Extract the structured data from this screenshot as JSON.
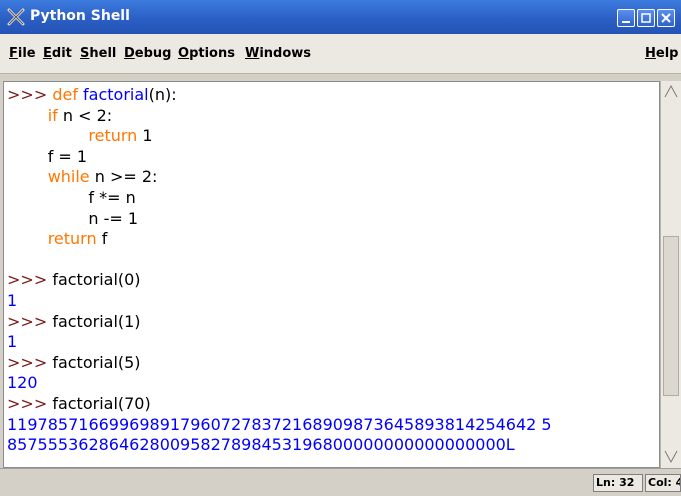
{
  "window": {
    "title": "Python Shell"
  },
  "menu": [
    "File",
    "Edit",
    "Shell",
    "Debug",
    "Options",
    "Windows",
    "Help"
  ],
  "shell": {
    "lines": [
      [
        {
          "t": ">>> ",
          "c": "prompt"
        },
        {
          "t": "def ",
          "c": "kw"
        },
        {
          "t": "factorial",
          "c": "fn"
        },
        {
          "t": "(n):",
          "c": "plain"
        }
      ],
      [
        {
          "t": "        ",
          "c": "plain"
        },
        {
          "t": "if",
          "c": "kw"
        },
        {
          "t": " n < 2:",
          "c": "plain"
        }
      ],
      [
        {
          "t": "                ",
          "c": "plain"
        },
        {
          "t": "return",
          "c": "kw"
        },
        {
          "t": " 1",
          "c": "plain"
        }
      ],
      [
        {
          "t": "        f = 1",
          "c": "plain"
        }
      ],
      [
        {
          "t": "        ",
          "c": "plain"
        },
        {
          "t": "while",
          "c": "kw"
        },
        {
          "t": " n >= 2:",
          "c": "plain"
        }
      ],
      [
        {
          "t": "                f *= n",
          "c": "plain"
        }
      ],
      [
        {
          "t": "                n -= 1",
          "c": "plain"
        }
      ],
      [
        {
          "t": "        ",
          "c": "plain"
        },
        {
          "t": "return",
          "c": "kw"
        },
        {
          "t": " f",
          "c": "plain"
        }
      ],
      [
        {
          "t": " ",
          "c": "plain"
        }
      ],
      [
        {
          "t": ">>> ",
          "c": "prompt"
        },
        {
          "t": "factorial(0)",
          "c": "plain"
        }
      ],
      [
        {
          "t": "1",
          "c": "out"
        }
      ],
      [
        {
          "t": ">>> ",
          "c": "prompt"
        },
        {
          "t": "factorial(1)",
          "c": "plain"
        }
      ],
      [
        {
          "t": "1",
          "c": "out"
        }
      ],
      [
        {
          "t": ">>> ",
          "c": "prompt"
        },
        {
          "t": "factorial(5)",
          "c": "plain"
        }
      ],
      [
        {
          "t": "120",
          "c": "out"
        }
      ],
      [
        {
          "t": ">>> ",
          "c": "prompt"
        },
        {
          "t": "factorial(70)",
          "c": "plain"
        }
      ],
      [
        {
          "t": "1197857166996989179607278372168909873645893814254642 5",
          "c": "out"
        }
      ],
      [
        {
          "t": "8575553628646280095827898453196800000000000000000L",
          "c": "out"
        }
      ]
    ]
  },
  "status": {
    "line": "Ln: 32",
    "col": "Col: 4"
  }
}
